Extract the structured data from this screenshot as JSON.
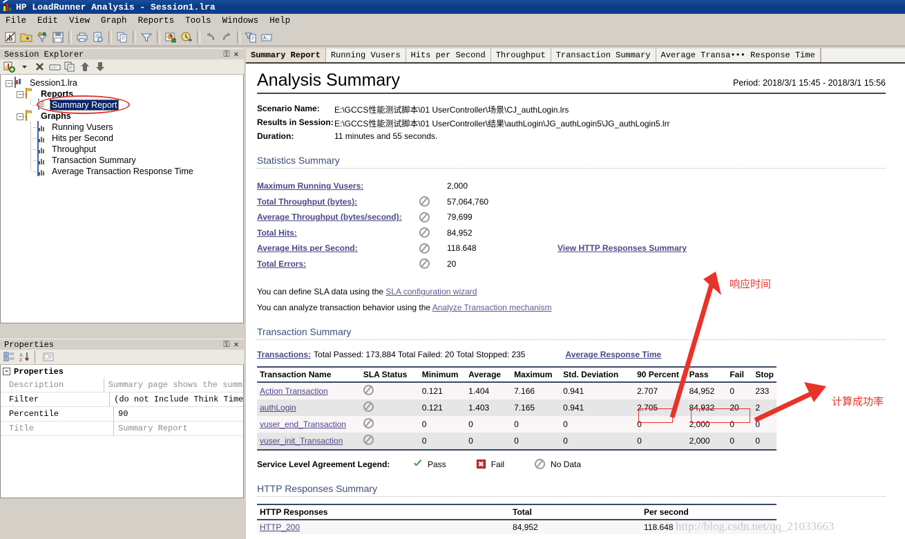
{
  "window": {
    "title": "HP LoadRunner Analysis - Session1.lra",
    "app_icon": "loadrunner-icon"
  },
  "menubar": {
    "items": [
      "File",
      "Edit",
      "View",
      "Graph",
      "Reports",
      "Tools",
      "Windows",
      "Help"
    ]
  },
  "toolbar": {
    "buttons": [
      "new-analysis-icon",
      "open-session-icon",
      "set-filter-tree-icon",
      "save-icon",
      "print-icon",
      "print-preview-icon",
      "copy-to-clipboard-icon",
      "filter-icon",
      "configure-graph-icon",
      "set-time-filter-icon",
      "undo-icon",
      "redo-icon",
      "apply-template-icon",
      "annotate-icon"
    ]
  },
  "session_explorer": {
    "caption": "Session Explorer",
    "pin_glyph": "⎯",
    "close_glyph": "✕",
    "toolbar": [
      "add-item-icon",
      "dropdown-arrow-icon",
      "delete-icon",
      "rename-icon",
      "duplicate-icon",
      "move-up-icon",
      "move-down-icon"
    ],
    "tree": {
      "root": "Session1.lra",
      "groups": [
        {
          "label": "Reports",
          "children": [
            {
              "label": "Summary Report",
              "selected": true,
              "icon": "report-icon",
              "circled": true
            }
          ]
        },
        {
          "label": "Graphs",
          "children": [
            {
              "label": "Running Vusers",
              "selected": false,
              "icon": "graph-icon"
            },
            {
              "label": "Hits per Second",
              "selected": false,
              "icon": "graph-icon"
            },
            {
              "label": "Throughput",
              "selected": false,
              "icon": "graph-icon"
            },
            {
              "label": "Transaction Summary",
              "selected": false,
              "icon": "graph-icon"
            },
            {
              "label": "Average Transaction Response Time",
              "selected": false,
              "icon": "graph-icon"
            }
          ]
        }
      ]
    }
  },
  "properties_panel": {
    "caption": "Properties",
    "pin_glyph": "⎯",
    "close_glyph": "✕",
    "toolbar": [
      "categorized-icon",
      "alphabetical-sort-icon",
      "property-pages-icon"
    ],
    "group_label": "Properties",
    "rows": [
      {
        "key": "Description",
        "value": "Summary page shows the summari",
        "dim": true
      },
      {
        "key": "Filter",
        "value": "(do not Include Think Time)",
        "dim": false
      },
      {
        "key": "Percentile",
        "value": "90",
        "dim": false
      },
      {
        "key": "Title",
        "value": "Summary Report",
        "dim": true
      }
    ]
  },
  "tabs": [
    {
      "label": "Summary Report",
      "active": true
    },
    {
      "label": "Running Vusers",
      "active": false
    },
    {
      "label": "Hits per Second",
      "active": false
    },
    {
      "label": "Throughput",
      "active": false
    },
    {
      "label": "Transaction Summary",
      "active": false
    },
    {
      "label": "Average Transa••• Response Time",
      "active": false
    }
  ],
  "report": {
    "title": "Analysis Summary",
    "period": "Period: 2018/3/1 15:45 - 2018/3/1 15:56",
    "meta": [
      {
        "label": "Scenario Name:",
        "value": "E:\\GCCS性能测试脚本\\01 UserController\\场景\\CJ_authLogin.lrs"
      },
      {
        "label": "Results in Session:",
        "value": "E:\\GCCS性能测试脚本\\01 UserController\\结果\\authLogin\\JG_authLogin5\\JG_authLogin5.lrr"
      },
      {
        "label": "Duration:",
        "value": "11 minutes and 55 seconds."
      }
    ],
    "statistics_heading": "Statistics Summary",
    "statistics": [
      {
        "name": "Maximum Running Vusers:",
        "sla": "none",
        "value": "2,000",
        "link": ""
      },
      {
        "name": "Total Throughput (bytes):",
        "sla": "nodata",
        "value": "57,064,760",
        "link": ""
      },
      {
        "name": "Average Throughput (bytes/second):",
        "sla": "nodata",
        "value": "79,699",
        "link": ""
      },
      {
        "name": "Total Hits:",
        "sla": "nodata",
        "value": "84,952",
        "link": ""
      },
      {
        "name": "Average Hits per Second:",
        "sla": "nodata",
        "value": "118.648",
        "link": "View HTTP Responses Summary"
      },
      {
        "name": "Total Errors:",
        "sla": "nodata",
        "value": "20",
        "link": ""
      }
    ],
    "sla_notes": [
      {
        "text_before": "You can define SLA data using the ",
        "link": "SLA configuration wizard",
        "text_after": ""
      },
      {
        "text_before": "You can analyze transaction behavior using the ",
        "link": "Analyze Transaction mechanism",
        "text_after": ""
      }
    ],
    "transaction_heading": "Transaction Summary",
    "transactions_line": {
      "lead": "Transactions:",
      "text": "Total Passed: 173,884 Total Failed: 20 Total Stopped: 235",
      "link": "Average Response Time"
    },
    "transaction_table": {
      "columns": [
        "Transaction Name",
        "SLA Status",
        "Minimum",
        "Average",
        "Maximum",
        "Std. Deviation",
        "90 Percent",
        "Pass",
        "Fail",
        "Stop"
      ],
      "rows": [
        {
          "name": "Action Transaction",
          "sla": "nodata",
          "min": "0.121",
          "avg": "1.404",
          "max": "7.166",
          "std": "0.941",
          "p90": "2.707",
          "pass": "84,952",
          "fail": "0",
          "stop": "233"
        },
        {
          "name": "authLogin",
          "sla": "nodata",
          "min": "0.121",
          "avg": "1.403",
          "max": "7.165",
          "std": "0.941",
          "p90": "2.705",
          "pass": "84,932",
          "fail": "20",
          "stop": "2"
        },
        {
          "name": "vuser_end_Transaction",
          "sla": "nodata",
          "min": "0",
          "avg": "0",
          "max": "0",
          "std": "0",
          "p90": "0",
          "pass": "2,000",
          "fail": "0",
          "stop": "0"
        },
        {
          "name": "vuser_init_Transaction",
          "sla": "nodata",
          "min": "0",
          "avg": "0",
          "max": "0",
          "std": "0",
          "p90": "0",
          "pass": "2,000",
          "fail": "0",
          "stop": "0"
        }
      ]
    },
    "legend": {
      "title": "Service Level Agreement Legend:",
      "items": [
        {
          "icon": "pass-check-icon",
          "label": "Pass"
        },
        {
          "icon": "fail-x-icon",
          "label": "Fail"
        },
        {
          "icon": "no-data-icon",
          "label": "No Data"
        }
      ]
    },
    "http_heading": "HTTP Responses Summary",
    "http_table": {
      "columns": [
        "HTTP Responses",
        "Total",
        "Per second"
      ],
      "rows": [
        {
          "name": "HTTP_200",
          "total": "84,952",
          "per_second": "118.648"
        }
      ]
    }
  },
  "annotations": {
    "response_time": "响应时间",
    "success_rate": "计算成功率",
    "arrow_color": "#e8332a"
  },
  "watermark": "http://blog.csdn.net/qq_21033663"
}
